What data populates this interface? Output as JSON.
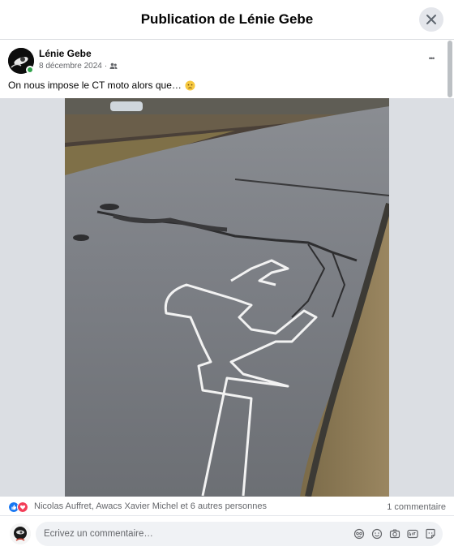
{
  "dialog": {
    "title": "Publication de Lénie Gebe",
    "close_icon": "close-icon"
  },
  "post": {
    "author": "Lénie Gebe",
    "date": "8 décembre 2024",
    "separator": "·",
    "audience_icon": "friends-icon",
    "text": "On nous impose le CT moto alors que…",
    "emoji": "worried-face-emoji",
    "more_icon": "more-options-icon",
    "more_label": "•••"
  },
  "photo": {
    "description_icon": "post-photo"
  },
  "reactions": {
    "icons": [
      "like-icon",
      "love-icon"
    ],
    "names": "Nicolas Auffret, Awacs Xavier Michel et 6 autres personnes",
    "comment_count": "1 commentaire"
  },
  "composer": {
    "placeholder": "Écrivez un commentaire…",
    "tools": [
      "avatar-sticker-icon",
      "emoji-icon",
      "camera-icon",
      "gif-icon",
      "sticker-icon"
    ]
  },
  "colors": {
    "accent": "#1877f2",
    "love": "#f33e58",
    "online": "#31a24c",
    "muted": "#65676b",
    "backdrop": "#dbdee3"
  }
}
